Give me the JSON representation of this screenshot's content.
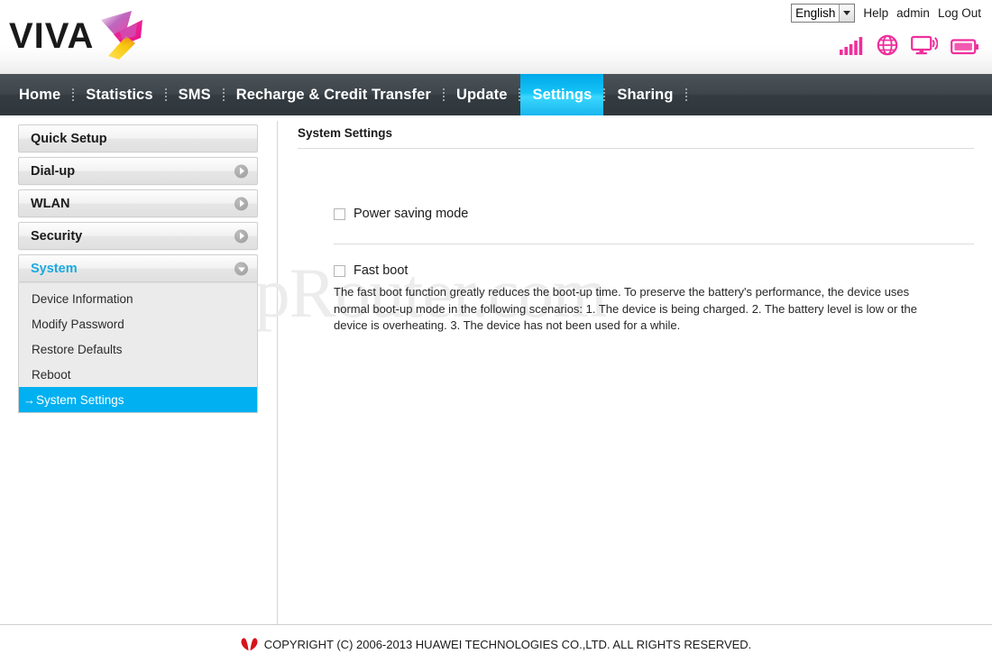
{
  "header": {
    "brand": "VIVA",
    "brand_mark_icon": "viva-bird-logo",
    "language": {
      "selected": "English",
      "options": [
        "English"
      ]
    },
    "links": [
      {
        "label": "Help",
        "name": "help-link"
      },
      {
        "label": "admin",
        "name": "admin-link"
      },
      {
        "label": "Log Out",
        "name": "logout-link"
      }
    ],
    "status_icons": [
      {
        "name": "signal-bars-icon",
        "label": "Signal strength",
        "color": "#ee2f9c"
      },
      {
        "name": "globe-icon",
        "label": "Network",
        "color": "#ee2f9c"
      },
      {
        "name": "monitor-wifi-icon",
        "label": "WLAN",
        "color": "#ee2f9c"
      },
      {
        "name": "battery-icon",
        "label": "Battery",
        "color": "#ee2f9c"
      }
    ]
  },
  "nav": {
    "items": [
      {
        "label": "Home",
        "active": false
      },
      {
        "label": "Statistics",
        "active": false
      },
      {
        "label": "SMS",
        "active": false
      },
      {
        "label": "Recharge & Credit Transfer",
        "active": false
      },
      {
        "label": "Update",
        "active": false
      },
      {
        "label": "Settings",
        "active": true
      },
      {
        "label": "Sharing",
        "active": false
      }
    ],
    "active_color": "#19b6ee"
  },
  "watermark": {
    "text": "SetupRouter.com"
  },
  "sidebar": {
    "items": [
      {
        "label": "Quick Setup",
        "state": "plain",
        "icon": null
      },
      {
        "label": "Dial-up",
        "state": "collapsed",
        "icon": "chevron-right-icon"
      },
      {
        "label": "WLAN",
        "state": "collapsed",
        "icon": "chevron-right-icon"
      },
      {
        "label": "Security",
        "state": "collapsed",
        "icon": "chevron-right-icon"
      },
      {
        "label": "System",
        "state": "expanded",
        "icon": "chevron-down-icon"
      }
    ],
    "system_submenu": [
      {
        "label": "Device Information",
        "active": false
      },
      {
        "label": "Modify Password",
        "active": false
      },
      {
        "label": "Restore Defaults",
        "active": false
      },
      {
        "label": "Reboot",
        "active": false
      },
      {
        "label": "System Settings",
        "active": true,
        "prefix": "→"
      }
    ],
    "active_color": "#00b0f0"
  },
  "main": {
    "title": "System Settings",
    "power_saving": {
      "label": "Power saving mode",
      "checked": false
    },
    "fast_boot": {
      "label": "Fast boot",
      "checked": false,
      "description": "The fast boot function greatly reduces the boot-up time.\nTo preserve the battery's performance, the device uses normal boot-up mode in the following scenarios: 1. The device is being charged. 2. The battery level is low or the device is overheating. 3. The device has not been used for a while."
    }
  },
  "footer": {
    "logo_icon": "huawei-flower-logo",
    "copyright": "COPYRIGHT (C) 2006-2013 HUAWEI TECHNOLOGIES CO.,LTD. ALL RIGHTS RESERVED."
  }
}
